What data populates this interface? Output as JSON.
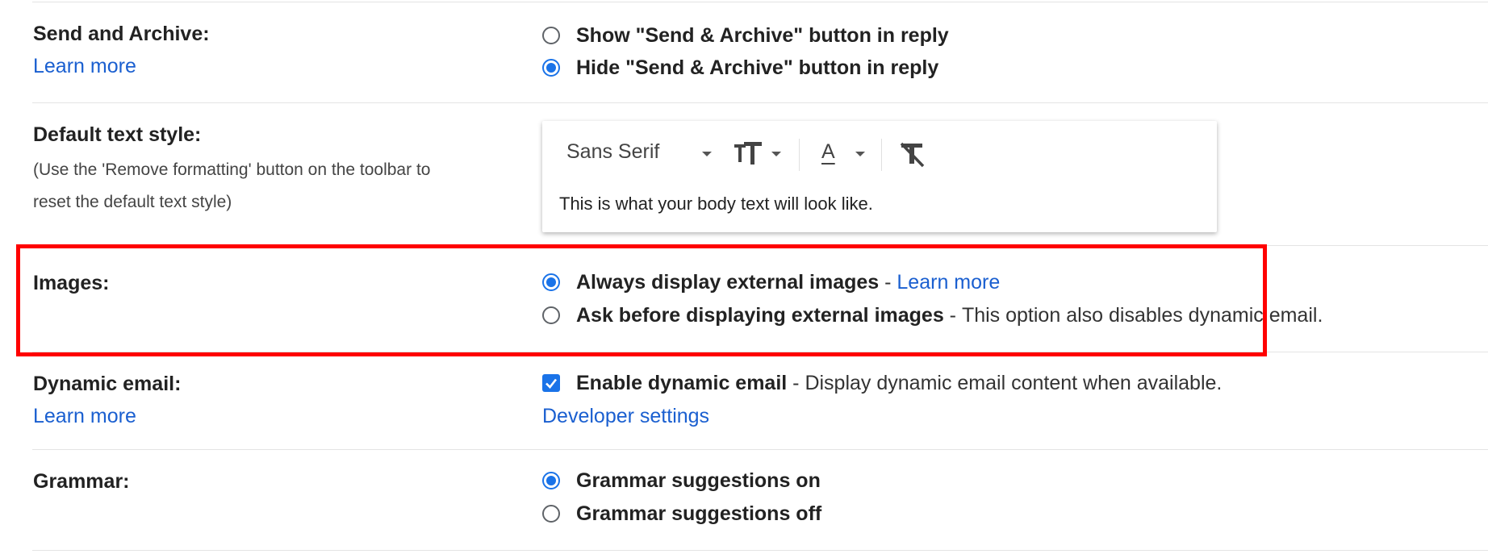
{
  "send_archive": {
    "label": "Send and Archive:",
    "learn_more": "Learn more",
    "options": [
      {
        "label": "Show \"Send & Archive\" button in reply",
        "selected": false
      },
      {
        "label": "Hide \"Send & Archive\" button in reply",
        "selected": true
      }
    ]
  },
  "text_style": {
    "label": "Default text style:",
    "note_line1": "(Use the 'Remove formatting' button on the toolbar to",
    "note_line2": "reset the default text style)",
    "font": "Sans Serif",
    "text_color_letter": "A",
    "preview": "This is what your body text will look like."
  },
  "images": {
    "label": "Images:",
    "options": [
      {
        "label": "Always display external images",
        "separator": " - ",
        "link": "Learn more",
        "selected": true
      },
      {
        "label": "Ask before displaying external images",
        "separator": " - ",
        "desc": "This option also disables dynamic email.",
        "selected": false
      }
    ]
  },
  "dynamic_email": {
    "label": "Dynamic email:",
    "learn_more": "Learn more",
    "checkbox_label": "Enable dynamic email",
    "separator": " - ",
    "desc": "Display dynamic email content when available.",
    "checked": true,
    "developer_link": "Developer settings"
  },
  "grammar": {
    "label": "Grammar:",
    "options": [
      {
        "label": "Grammar suggestions on",
        "selected": true
      },
      {
        "label": "Grammar suggestions off",
        "selected": false
      }
    ]
  },
  "colors": {
    "accent": "#1a73e8",
    "link": "#1a5fd0",
    "highlight": "#ff0000"
  }
}
